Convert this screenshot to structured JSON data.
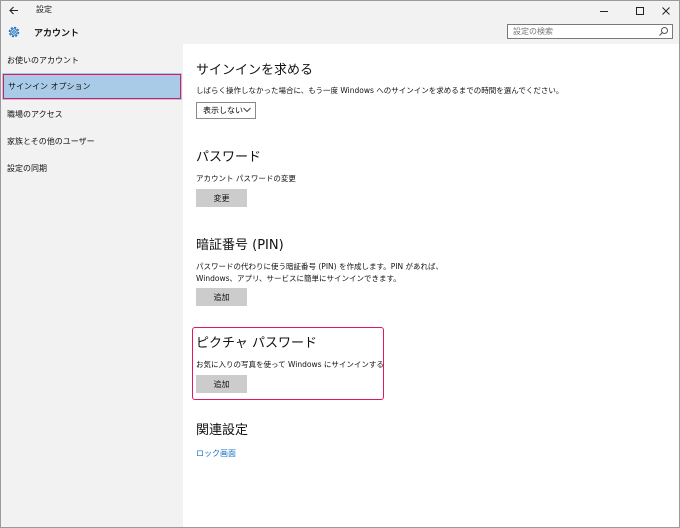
{
  "window": {
    "title": "設定",
    "controls": {
      "minimize": "minimize-icon",
      "maximize": "maximize-icon",
      "close": "close-icon"
    }
  },
  "header": {
    "title": "アカウント",
    "search_placeholder": "設定の検索"
  },
  "sidebar": {
    "items": [
      {
        "label": "お使いのアカウント",
        "selected": false
      },
      {
        "label": "サインイン オプション",
        "selected": true
      },
      {
        "label": "職場のアクセス",
        "selected": false
      },
      {
        "label": "家族とその他のユーザー",
        "selected": false
      },
      {
        "label": "設定の同期",
        "selected": false
      }
    ]
  },
  "main": {
    "require_signin": {
      "heading": "サインインを求める",
      "description": "しばらく操作しなかった場合に、もう一度 Windows へのサインインを求めるまでの時間を選んでください。",
      "dropdown_value": "表示しない"
    },
    "password": {
      "heading": "パスワード",
      "description": "アカウント パスワードの変更",
      "button": "変更"
    },
    "pin": {
      "heading": "暗証番号 (PIN)",
      "description_line1": "パスワードの代わりに使う暗証番号 (PIN) を作成します。PIN があれば、",
      "description_line2": "Windows、アプリ、サービスに簡単にサインインできます。",
      "button": "追加"
    },
    "picture_password": {
      "heading": "ピクチャ パスワード",
      "description": "お気に入りの写真を使って Windows にサインインする",
      "button": "追加"
    },
    "related": {
      "heading": "関連設定",
      "link": "ロック画面"
    }
  },
  "colors": {
    "accent_link": "#1a6fc4",
    "selected_nav_bg": "#a9cbe8",
    "highlight_border": "#e0195a",
    "sidebar_bg": "#f2f2f2",
    "button_bg": "#cccccc"
  }
}
